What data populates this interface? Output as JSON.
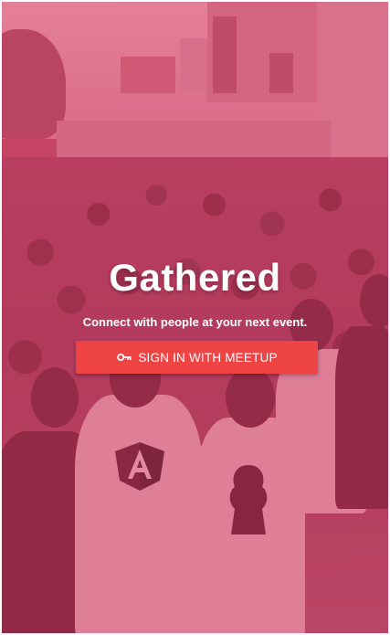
{
  "app": {
    "title": "Gathered",
    "tagline": "Connect with people at your next event."
  },
  "signin": {
    "label": "SIGN IN WITH MEETUP",
    "icon": "key-icon"
  },
  "colors": {
    "overlay": "#dc3c64",
    "button": "#ef4444",
    "text": "#ffffff"
  }
}
